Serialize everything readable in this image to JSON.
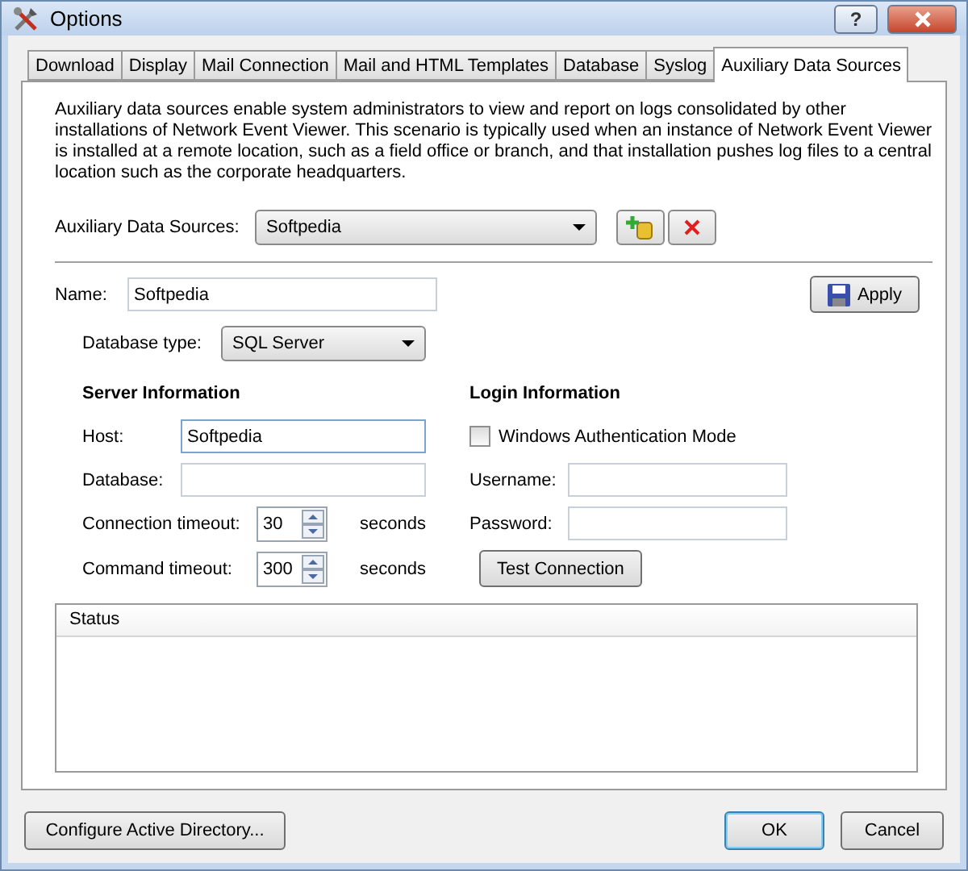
{
  "window": {
    "title": "Options",
    "help": "?"
  },
  "tabs": [
    {
      "label": "Download",
      "selected": false
    },
    {
      "label": "Display",
      "selected": false
    },
    {
      "label": "Mail Connection",
      "selected": false
    },
    {
      "label": "Mail and HTML Templates",
      "selected": false
    },
    {
      "label": "Database",
      "selected": false
    },
    {
      "label": "Syslog",
      "selected": false
    },
    {
      "label": "Auxiliary Data Sources",
      "selected": true
    }
  ],
  "description": "Auxiliary data sources enable system administrators to view and report on logs consolidated by other installations of Network Event Viewer.  This scenario is typically used when an instance of Network Event Viewer is installed at a remote location, such as a field office or branch, and that installation pushes log files to a central location such as the corporate headquarters.",
  "sources": {
    "label": "Auxiliary Data Sources:",
    "value": "Softpedia"
  },
  "name": {
    "label": "Name:",
    "value": "Softpedia"
  },
  "apply_button": "Apply",
  "database_type": {
    "label": "Database type:",
    "value": "SQL Server"
  },
  "server": {
    "heading": "Server Information",
    "host": {
      "label": "Host:",
      "value": "Softpedia"
    },
    "database": {
      "label": "Database:"
    },
    "timeouts": [
      {
        "label": "Connection timeout:",
        "value": "30",
        "unit": "seconds"
      },
      {
        "label": "Command timeout:",
        "value": "300",
        "unit": "seconds"
      }
    ]
  },
  "login": {
    "heading": "Login Information",
    "windows_auth": {
      "label": "Windows Authentication Mode",
      "checked": false
    },
    "username": {
      "label": "Username:"
    },
    "password": {
      "label": "Password:"
    },
    "test_button": "Test Connection"
  },
  "status": {
    "header": "Status"
  },
  "footer": [
    {
      "label": "Configure Active Directory...",
      "default": false
    },
    {
      "label": "OK",
      "default": true
    },
    {
      "label": "Cancel",
      "default": false
    }
  ]
}
